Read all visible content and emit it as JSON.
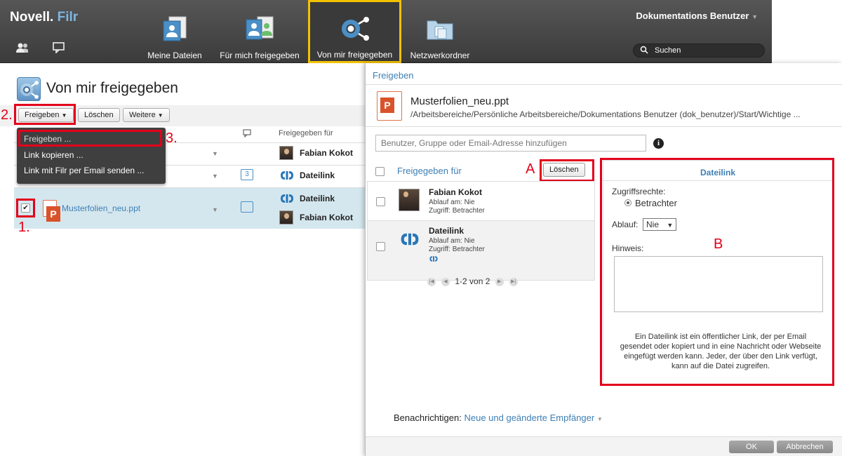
{
  "brand": {
    "name": "Novell.",
    "product": "Filr"
  },
  "nav": {
    "items": [
      {
        "label": "Meine Dateien",
        "icon": "my-files-icon"
      },
      {
        "label": "Für mich freigegeben",
        "icon": "shared-with-me-icon"
      },
      {
        "label": "Von mir freigegeben",
        "icon": "shared-by-me-icon",
        "active": true
      },
      {
        "label": "Netzwerkordner",
        "icon": "network-folder-icon"
      }
    ],
    "user": "Dokumentations Benutzer",
    "search_placeholder": "Suchen"
  },
  "page": {
    "title": "Von mir freigegeben",
    "toolbar": {
      "share": "Freigeben",
      "delete": "Löschen",
      "more": "Weitere"
    },
    "menu": [
      "Freigeben ...",
      "Link kopieren ...",
      "Link mit Filr per Email senden ..."
    ],
    "columns": {
      "shared_for": "Freigegeben für"
    },
    "rows": [
      {
        "filename": "",
        "comments": "",
        "shared_with": [
          "Fabian Kokot"
        ]
      },
      {
        "filename": "",
        "comments": "3",
        "shared_with": [
          "Dateilink"
        ]
      },
      {
        "filename": "Musterfolien_neu.ppt",
        "comments": "",
        "shared_with": [
          "Dateilink",
          "Fabian Kokot"
        ],
        "selected": true
      }
    ]
  },
  "annotations": {
    "step1": "1.",
    "step2": "2.",
    "step3": "3.",
    "markA": "A",
    "markB": "B"
  },
  "dialog": {
    "title": "Freigeben",
    "filename": "Musterfolien_neu.ppt",
    "path": "/Arbeitsbereiche/Persönliche Arbeitsbereiche/Dokumentations Benutzer (dok_benutzer)/Start/Wichtige ...",
    "add_placeholder": "Benutzer, Gruppe oder Email-Adresse hinzufügen",
    "list_header": "Freigegeben für",
    "delete_label": "Löschen",
    "entries": [
      {
        "name": "Fabian Kokot",
        "expiry": "Ablauf am: Nie",
        "access": "Zugriff: Betrachter"
      },
      {
        "name": "Dateilink",
        "expiry": "Ablauf am: Nie",
        "access": "Zugriff: Betrachter"
      }
    ],
    "pager": "1-2 von 2",
    "detail": {
      "title": "Dateilink",
      "rights_label": "Zugriffsrechte:",
      "rights_value": "Betrachter",
      "expiry_label": "Ablauf:",
      "expiry_value": "Nie",
      "note_label": "Hinweis:",
      "description": "Ein Dateilink ist ein öffentlicher Link, der per Email gesendet oder kopiert und in eine Nachricht oder Webseite eingefügt werden kann. Jeder, der über den Link verfügt, kann auf die Datei zugreifen."
    },
    "notify_label": "Benachrichtigen:",
    "notify_value": "Neue und geänderte Empfänger",
    "ok": "OK",
    "cancel": "Abbrechen"
  },
  "colors": {
    "accent": "#3e7fb5",
    "highlight": "#f2c200",
    "annotation": "#e3001b",
    "selected_row": "#d4e7ee"
  }
}
